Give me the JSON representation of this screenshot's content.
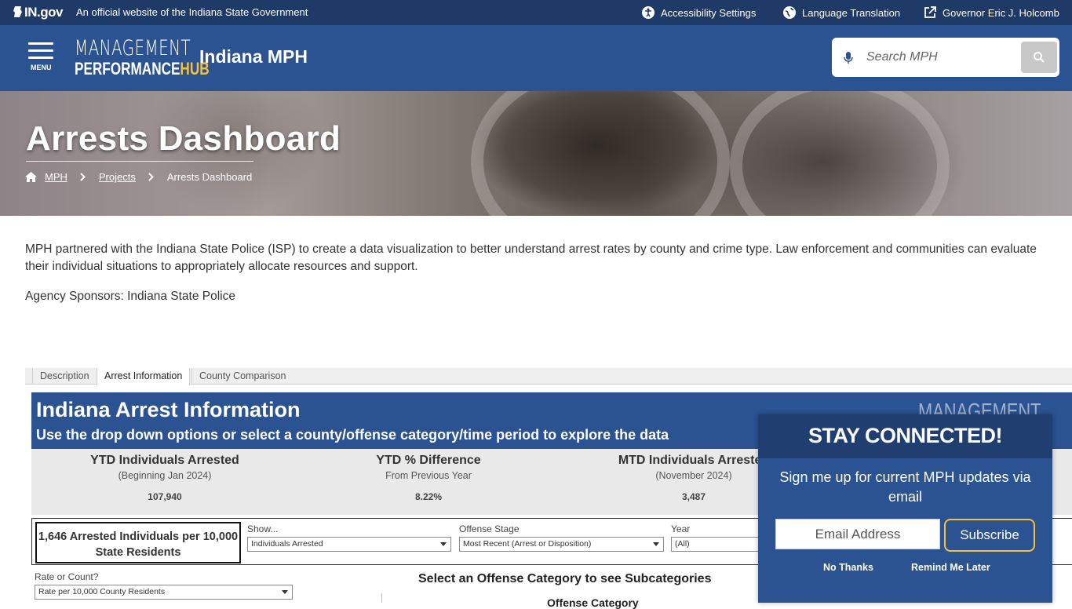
{
  "topbar": {
    "logo_text": "IN.gov",
    "official_text": "An official website of the Indiana State Government",
    "links": [
      {
        "label": "Accessibility Settings",
        "icon": "accessibility-icon"
      },
      {
        "label": "Language Translation",
        "icon": "globe-icon"
      },
      {
        "label": "Governor Eric J. Holcomb",
        "icon": "external-link-icon"
      }
    ]
  },
  "header": {
    "menu_label": "MENU",
    "logo_line1": "MANAGEMENT",
    "logo_line2a": "PERFORMANCE",
    "logo_line2b": "HUB",
    "site_title": "Indiana MPH",
    "search_placeholder": "Search MPH"
  },
  "hero": {
    "title": "Arrests Dashboard",
    "breadcrumbs": [
      {
        "label": "MPH",
        "link": true
      },
      {
        "label": "Projects",
        "link": true
      },
      {
        "label": "Arrests Dashboard",
        "link": false
      }
    ]
  },
  "intro": {
    "paragraph": "MPH partnered with the Indiana State Police (ISP) to create a data visualization to better understand arrest rates by county and crime type. Law enforcement and communities can evaluate their individual situations to appropriately allocate resources and support.",
    "sponsors": "Agency Sponsors: Indiana State Police"
  },
  "tabs": [
    "Description",
    "Arrest Information",
    "County Comparison"
  ],
  "dashboard": {
    "title": "Indiana Arrest Information",
    "subtitle": "Use the drop down options or select a county/offense category/time period to explore the data",
    "watermark": "MANAGEMENT",
    "kpis": [
      {
        "title": "YTD Individuals Arrested",
        "sub": "(Beginning Jan 2024)",
        "value": "107,940"
      },
      {
        "title": "YTD % Difference",
        "sub": "From Previous Year",
        "value": "8.22%"
      },
      {
        "title": "MTD Individuals Arrested",
        "sub": "(November 2024)",
        "value": "3,487"
      }
    ],
    "rate_box": "1,646 Arrested Individuals per 10,000 State Residents",
    "filters": [
      {
        "label": "Show...",
        "value": "Individuals Arrested"
      },
      {
        "label": "Offense Stage",
        "value": "Most Recent (Arrest or Disposition)"
      },
      {
        "label": "Year",
        "value": "(All)"
      }
    ],
    "rate_or_count": {
      "label": "Rate or Count?",
      "value": "Rate per 10,000 County Residents"
    },
    "select_category": "Select an Offense Category to see Subcategories",
    "offense_category_heading": "Offense Category"
  },
  "popup": {
    "title": "STAY CONNECTED!",
    "description": "Sign me up for current MPH updates via email",
    "email_placeholder": "Email Address",
    "subscribe_label": "Subscribe",
    "no_thanks": "No Thanks",
    "remind_later": "Remind Me Later"
  },
  "colors": {
    "brand_blue": "#2b5291",
    "top_bar": "#1f3a66",
    "accent_gold": "#f4c23e"
  }
}
